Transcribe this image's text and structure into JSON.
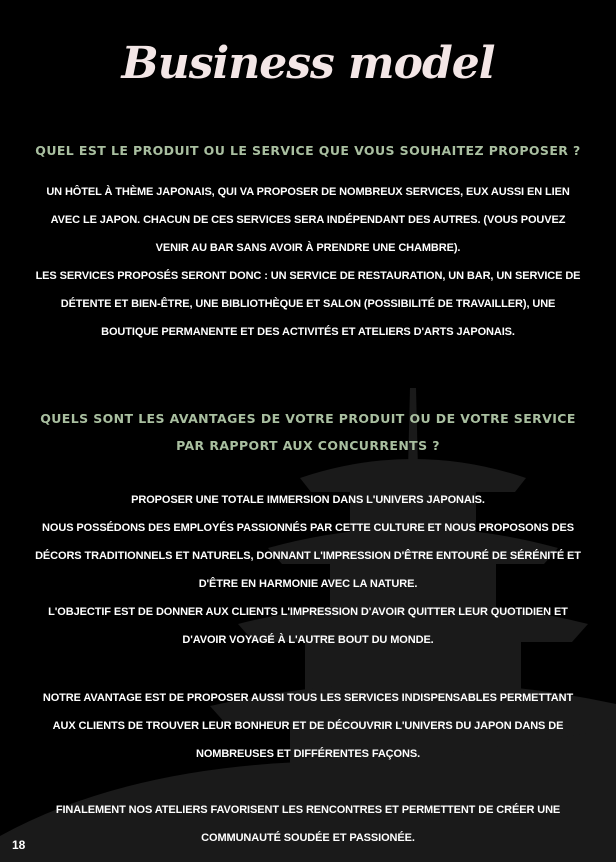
{
  "page": {
    "title": "Business model",
    "page_number": "18"
  },
  "section1": {
    "question": "QUEL EST LE PRODUIT OU LE SERVICE QUE VOUS SOUHAITEZ PROPOSER ?",
    "para1": "UN HÔTEL À THÈME JAPONAIS, QUI VA PROPOSER DE NOMBREUX SERVICES, EUX AUSSI EN LIEN AVEC LE JAPON. CHACUN DE CES SERVICES SERA INDÉPENDANT DES AUTRES. (VOUS POUVEZ VENIR AU BAR SANS AVOIR À PRENDRE UNE CHAMBRE).",
    "para2": "LES SERVICES PROPOSÉS SERONT DONC : UN SERVICE DE RESTAURATION, UN BAR, UN SERVICE DE DÉTENTE ET BIEN-ÊTRE, UNE BIBLIOTHÈQUE ET SALON (POSSIBILITÉ DE TRAVAILLER), UNE BOUTIQUE PERMANENTE ET DES ACTIVITÉS ET ATELIERS D'ARTS JAPONAIS."
  },
  "section2": {
    "question": "QUELS SONT LES AVANTAGES DE VOTRE PRODUIT OU DE VOTRE SERVICE PAR RAPPORT AUX CONCURRENTS ?",
    "para1": "PROPOSER UNE TOTALE IMMERSION DANS L'UNIVERS JAPONAIS.",
    "para2": "NOUS POSSÉDONS DES EMPLOYÉS PASSIONNÉS PAR CETTE CULTURE ET NOUS PROPOSONS DES DÉCORS TRADITIONNELS ET NATURELS, DONNANT L'IMPRESSION D'ÊTRE ENTOURÉ DE SÉRÉNITÉ ET D'ÊTRE EN HARMONIE AVEC LA NATURE.",
    "para3": "L'OBJECTIF EST DE DONNER AUX CLIENTS L'IMPRESSION D'AVOIR QUITTER LEUR QUOTIDIEN ET D'AVOIR VOYAGÉ À L'AUTRE BOUT DU MONDE.",
    "para4": "NOTRE AVANTAGE EST DE PROPOSER AUSSI TOUS LES SERVICES INDISPENSABLES PERMETTANT AUX CLIENTS DE TROUVER LEUR BONHEUR ET DE DÉCOUVRIR L'UNIVERS DU JAPON DANS DE NOMBREUSES ET DIFFÉRENTES FAÇONS.",
    "para5": "FINALEMENT NOS ATELIERS FAVORISENT LES RENCONTRES ET PERMETTENT DE CRÉER UNE COMMUNAUTÉ SOUDÉE ET PASSIONÉE."
  },
  "colors": {
    "background": "#000000",
    "title": "#f3e6e6",
    "heading": "#a9bfa0",
    "body_text": "#ffffff",
    "pagoda_silhouette": "#1a1a1a"
  },
  "decor": {
    "background_icon": "pagoda-silhouette-icon"
  }
}
